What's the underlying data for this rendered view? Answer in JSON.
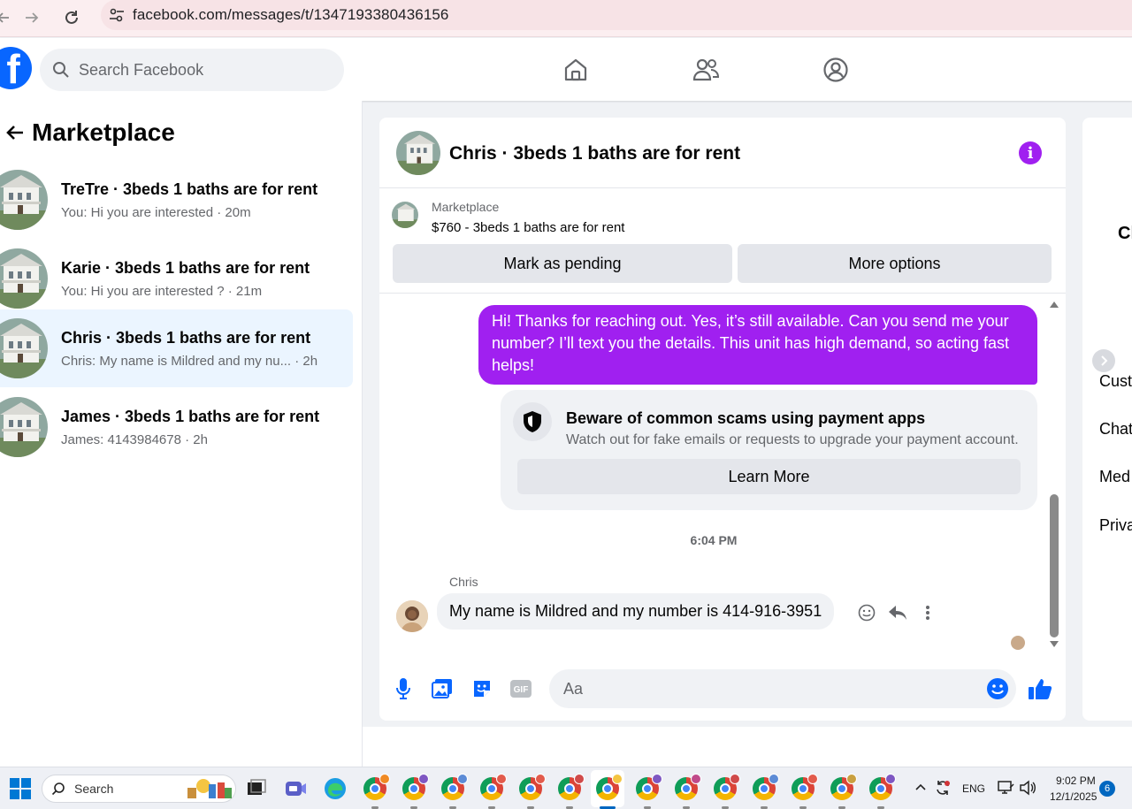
{
  "browser": {
    "url": "facebook.com/messages/t/1347193380436156"
  },
  "header": {
    "logo_letter": "f",
    "search_placeholder": "Search Facebook"
  },
  "sidebar": {
    "title": "Marketplace",
    "conversations": [
      {
        "title": "TreTre · 3beds 1 baths are for rent",
        "subtitle": "You: Hi you are interested · 20m",
        "active": false
      },
      {
        "title": "Karie · 3beds 1 baths are for rent",
        "subtitle": "You: Hi you are interested ? · 21m",
        "active": false
      },
      {
        "title": "Chris · 3beds 1 baths are for rent",
        "subtitle": "Chris: My name is Mildred and my nu... · 2h",
        "active": true
      },
      {
        "title": "James · 3beds 1 baths are for rent",
        "subtitle": "James: 4143984678 · 2h",
        "active": false
      }
    ]
  },
  "chat": {
    "title": "Chris · 3beds 1 baths are for rent",
    "listing": {
      "category": "Marketplace",
      "description": "$760 - 3beds 1 baths are for rent",
      "mark_pending_label": "Mark as pending",
      "more_options_label": "More options"
    },
    "outgoing_message": "Hi! Thanks for reaching out. Yes, it’s still available. Can you send me your number? I’ll text you the details. This unit has high demand, so acting fast helps!",
    "scam_warning": {
      "title": "Beware of common scams using payment apps",
      "text": "Watch out for fake emails or requests to upgrade your payment account.",
      "button_label": "Learn More"
    },
    "timestamp": "6:04 PM",
    "sender_name": "Chris",
    "incoming_message": "My name is Mildred and my number is 414-916-3951",
    "composer_placeholder": "Aa",
    "accent_color": "#a020f0"
  },
  "right_panel": {
    "items": [
      "Cl",
      "Cust",
      "Chat",
      "Med",
      "Priva"
    ]
  },
  "taskbar": {
    "search_label": "Search",
    "language": "ENG",
    "time": "9:02 PM",
    "date": "12/1/2025",
    "notification_count": "6"
  }
}
